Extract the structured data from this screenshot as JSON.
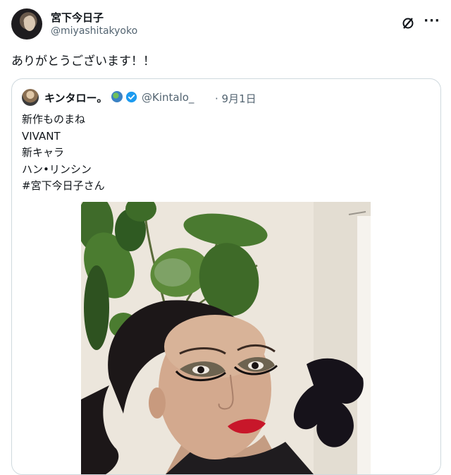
{
  "tweet": {
    "author_name": "宮下今日子",
    "author_handle": "@miyashitakyoko",
    "text": "ありがとうございます！！",
    "more_label": "···"
  },
  "quote": {
    "author_name": "キンタロー。",
    "author_handle": "@Kintalo_",
    "date": "· 9月1日",
    "lines": [
      "新作ものまね",
      "VIVANT",
      "新キャラ",
      "ハン•リンシン",
      "#宮下今日子さん"
    ]
  },
  "colors": {
    "verified": "#1d9bf0",
    "secondary_text": "#536471",
    "border": "#cfd9de",
    "lipstick": "#c8172a"
  },
  "icons": {
    "grok": "grok-icon",
    "more": "more-icon",
    "verified": "verified-badge-icon",
    "globe": "globe-emoji-icon"
  }
}
